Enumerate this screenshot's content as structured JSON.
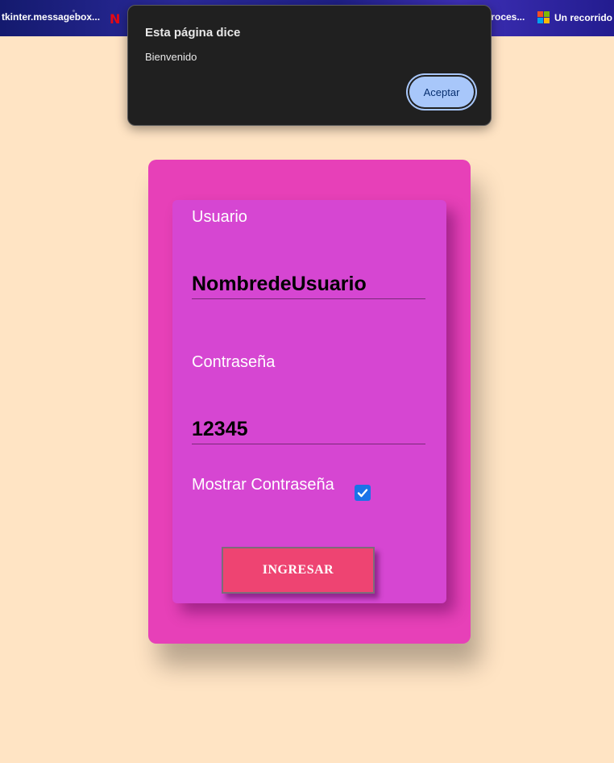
{
  "bookmarks": [
    {
      "label": "tkinter.messagebox..."
    },
    {
      "label": "N",
      "icon": "netflix-icon"
    },
    {
      "label": "proces..."
    },
    {
      "label": "Un recorrido",
      "icon": "microsoft-icon"
    }
  ],
  "dialog": {
    "title": "Esta página dice",
    "message": "Bienvenido",
    "button_label": "Aceptar"
  },
  "login": {
    "user_label": "Usuario",
    "user_value": "NombredeUsuario",
    "password_label": "Contraseña",
    "password_value": "12345",
    "show_password_label": "Mostrar Contraseña",
    "show_password_checked": true,
    "submit_label": "INGRESAR"
  },
  "colors": {
    "page_bg": "#ffe4c4",
    "outer_card": "#e740b8",
    "inner_card": "#d646d2",
    "submit_button": "#ee4472",
    "dialog_button": "#a8c7fa"
  }
}
